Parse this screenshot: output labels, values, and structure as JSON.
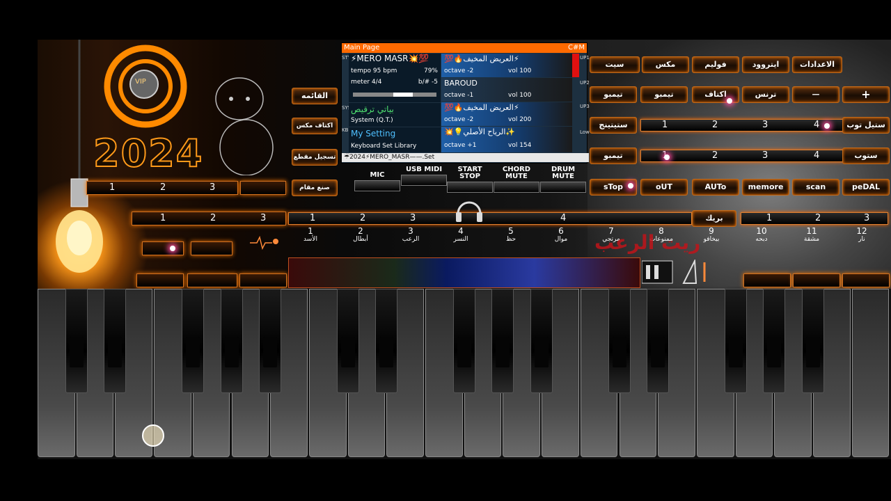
{
  "left": {
    "year": "2024",
    "badge": "VIP",
    "buttons": {
      "list": "القائمه",
      "mix_shoulders": "اكتاف مكس",
      "record_cut": "تسجيل مقطع",
      "make_maqam": "صنع مقام"
    },
    "rows": {
      "r1": [
        "1",
        "2",
        "3"
      ],
      "r2": [
        "1",
        "2",
        "3"
      ]
    }
  },
  "panel": {
    "title": "Main Page",
    "key": "C#M",
    "style": {
      "name": "⚡MERO MASR💥💯",
      "tempo": "tempo 95 bpm",
      "percent": "79%",
      "meter": "meter 4/4",
      "transpose": "b/# -5"
    },
    "upper1": {
      "name": "💯🔥العريض المخيف⚡",
      "octave": "octave -2",
      "vol": "vol 100"
    },
    "upper2": {
      "name": "BAROUD",
      "octave": "octave -1",
      "vol": "vol 100"
    },
    "upper3": {
      "name": "💯🔥العريض المخيف⚡",
      "octave": "octave -2",
      "vol": "vol 200"
    },
    "lower": {
      "name": "💥💡الرياح الأصلي✨",
      "octave": "octave +1",
      "vol": "vol 154"
    },
    "sys": {
      "name": "بياتي ترقيص",
      "sub": "System (Q.T.)"
    },
    "kbd": {
      "name": "My Setting",
      "sub": "Keyboard Set Library"
    },
    "footer": "☔2024⚡MERO_MASR——.Set",
    "side_labels": {
      "style": "STYLE",
      "sys": "SYS",
      "kbd": "KBD",
      "up1": "UP1",
      "up2": "UP2",
      "up3": "UP3",
      "low": "Low"
    }
  },
  "func_buttons": [
    "MIC",
    "USB MIDI",
    "START STOP",
    "CHORD MUTE",
    "DRUM MUTE"
  ],
  "right": {
    "row1": [
      "سيت",
      "مكس",
      "فوليم",
      "ايتروود",
      "الاعدادات"
    ],
    "row2": [
      "تيمبو",
      "تيمبو",
      "اكتاف",
      "ترنس",
      "—",
      "+"
    ],
    "setting_style": "ستيتينج",
    "style_top": "ستيل توب",
    "stop_label": "ستوب",
    "tempo_label": "تيمبو",
    "nums": [
      "1",
      "2",
      "3",
      "4"
    ],
    "row_controls": [
      "sTop",
      "oUT",
      "AUTo",
      "memore",
      "scan",
      "peDAL"
    ],
    "break": "بريك",
    "break_nums": [
      "1",
      "2",
      "3",
      "4"
    ],
    "break_nums2": [
      "1",
      "2",
      "3"
    ]
  },
  "pads": [
    {
      "n": "1",
      "label": "الأسد"
    },
    {
      "n": "2",
      "label": "أبطال"
    },
    {
      "n": "3",
      "label": "الرعب"
    },
    {
      "n": "4",
      "label": "النسر"
    },
    {
      "n": "5",
      "label": "حظ"
    },
    {
      "n": "6",
      "label": "موال"
    },
    {
      "n": "7",
      "label": "مرتجي"
    },
    {
      "n": "8",
      "label": "ممنوعات"
    },
    {
      "n": "9",
      "label": "بيخافو"
    },
    {
      "n": "10",
      "label": "دبحه"
    },
    {
      "n": "11",
      "label": "مشقة"
    },
    {
      "n": "12",
      "label": "نار"
    }
  ],
  "watermark": "ريت الرعب",
  "colors": {
    "accent": "#ff7a00",
    "panel_title": "#ff6a00",
    "highlight": "#1f5fa8"
  }
}
